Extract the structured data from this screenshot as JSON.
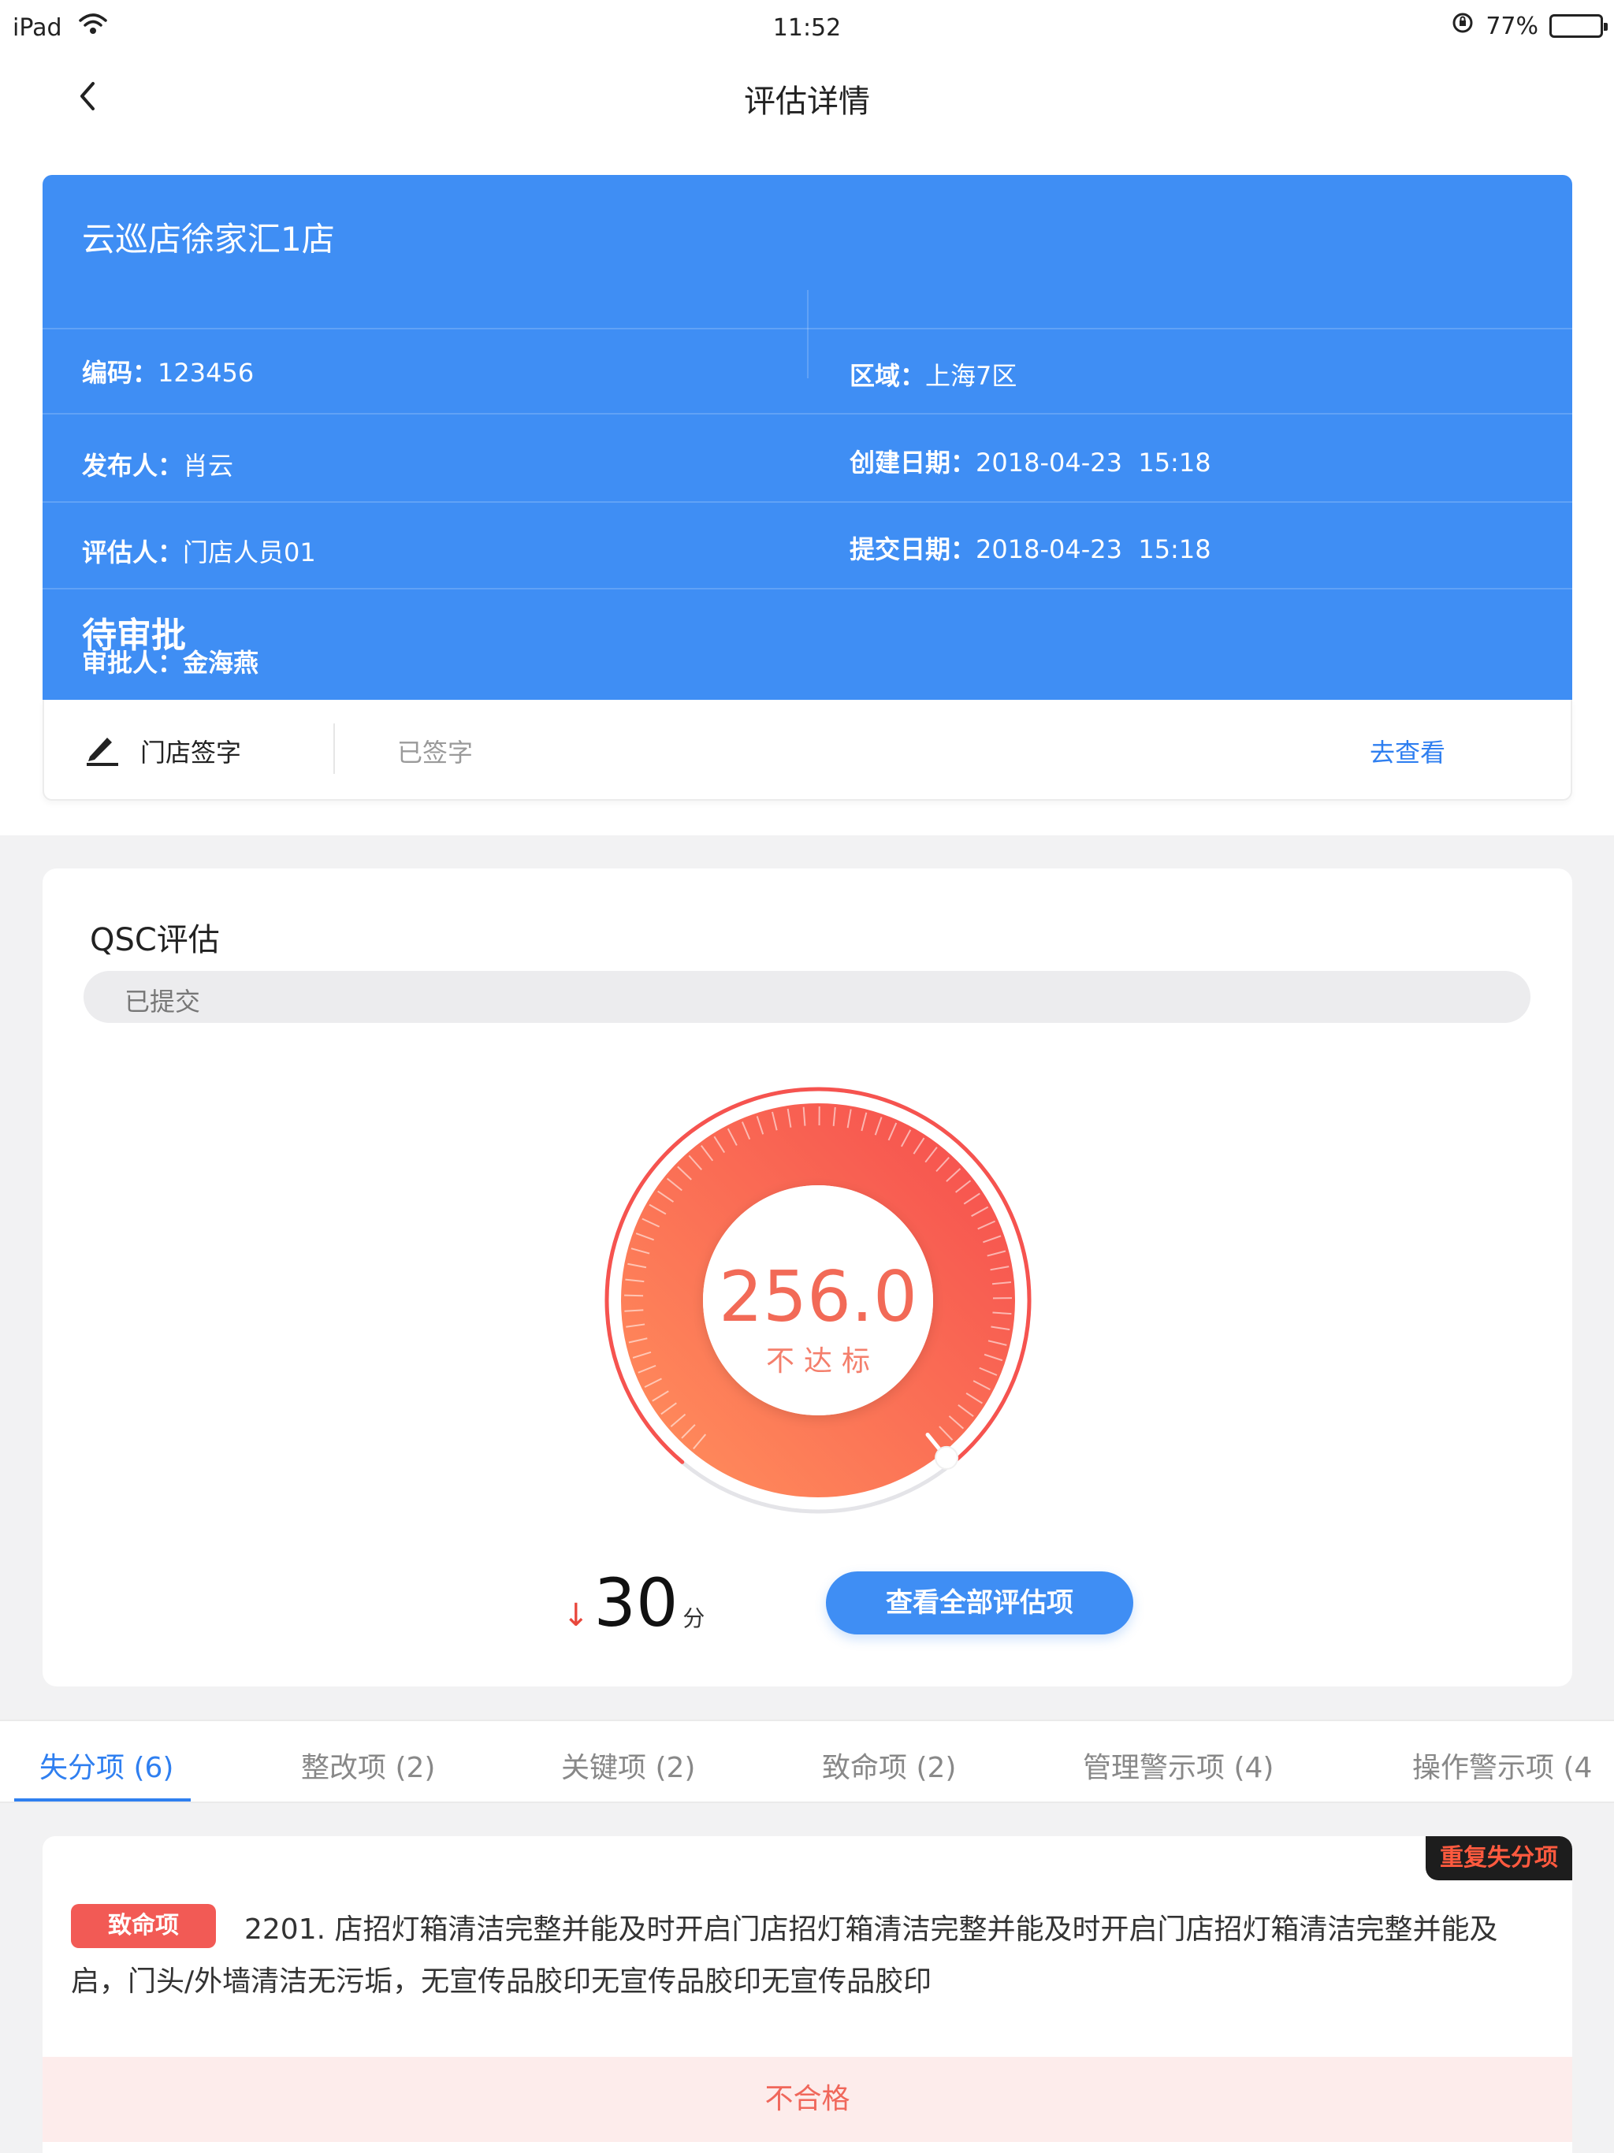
{
  "status_bar": {
    "device": "iPad",
    "time": "11:52",
    "battery": "77%",
    "battery_level": 0.77,
    "icons": [
      "wifi-icon",
      "orientation-lock-icon",
      "battery-icon"
    ]
  },
  "nav": {
    "title": "评估详情",
    "back_icon": "chevron-left-icon"
  },
  "store": {
    "name": "云巡店徐家汇1店",
    "code_label": "编码：",
    "code": "123456",
    "region_label": "区域：",
    "region": "上海7区",
    "publisher_label": "发布人：",
    "publisher": "肖云",
    "created_label": "创建日期：",
    "created": "2018-04-23  15:18",
    "assessor_label": "评估人：",
    "assessor": "门店人员01",
    "submitted_label": "提交日期：",
    "submitted": "2018-04-23  15:18",
    "status": "待审批",
    "approver_label": "审批人：",
    "approver": "金海燕",
    "card_color": "#3f8ef4"
  },
  "signature": {
    "icon": "pen-signature-icon",
    "label": "门店签字",
    "status": "已签字",
    "link": "去查看"
  },
  "qsc": {
    "title": "QSC评估",
    "status": "已提交",
    "score": "256.0",
    "verdict": "不达标",
    "gauge_fraction": 0.78,
    "delta_arrow": "↓",
    "delta": "30",
    "delta_unit": "分",
    "view_all_button": "查看全部评估项",
    "colors": {
      "gauge_start": "#ff8a5b",
      "gauge_end": "#f6534f",
      "accent": "#3f8ef4"
    }
  },
  "tabs": [
    {
      "label": "失分项 (6)",
      "active": true
    },
    {
      "label": "整改项 (2)",
      "active": false
    },
    {
      "label": "关键项 (2)",
      "active": false
    },
    {
      "label": "致命项 (2)",
      "active": false
    },
    {
      "label": "管理警示项 (4)",
      "active": false
    },
    {
      "label": "操作警示项 (4",
      "active": false
    }
  ],
  "item": {
    "badge": "重复失分项",
    "tag": "致命项",
    "text": "2201. 店招灯箱清洁完整并能及时开启门店招灯箱清洁完整并能及时开启门店招灯箱清洁完整并能及启，门头/外墙清洁无污垢，无宣传品胶印无宣传品胶印无宣传品胶印",
    "result": "不合格",
    "colors": {
      "tag": "#f25a55",
      "result_bg": "#fdeceb",
      "result_text": "#f0675b"
    }
  }
}
